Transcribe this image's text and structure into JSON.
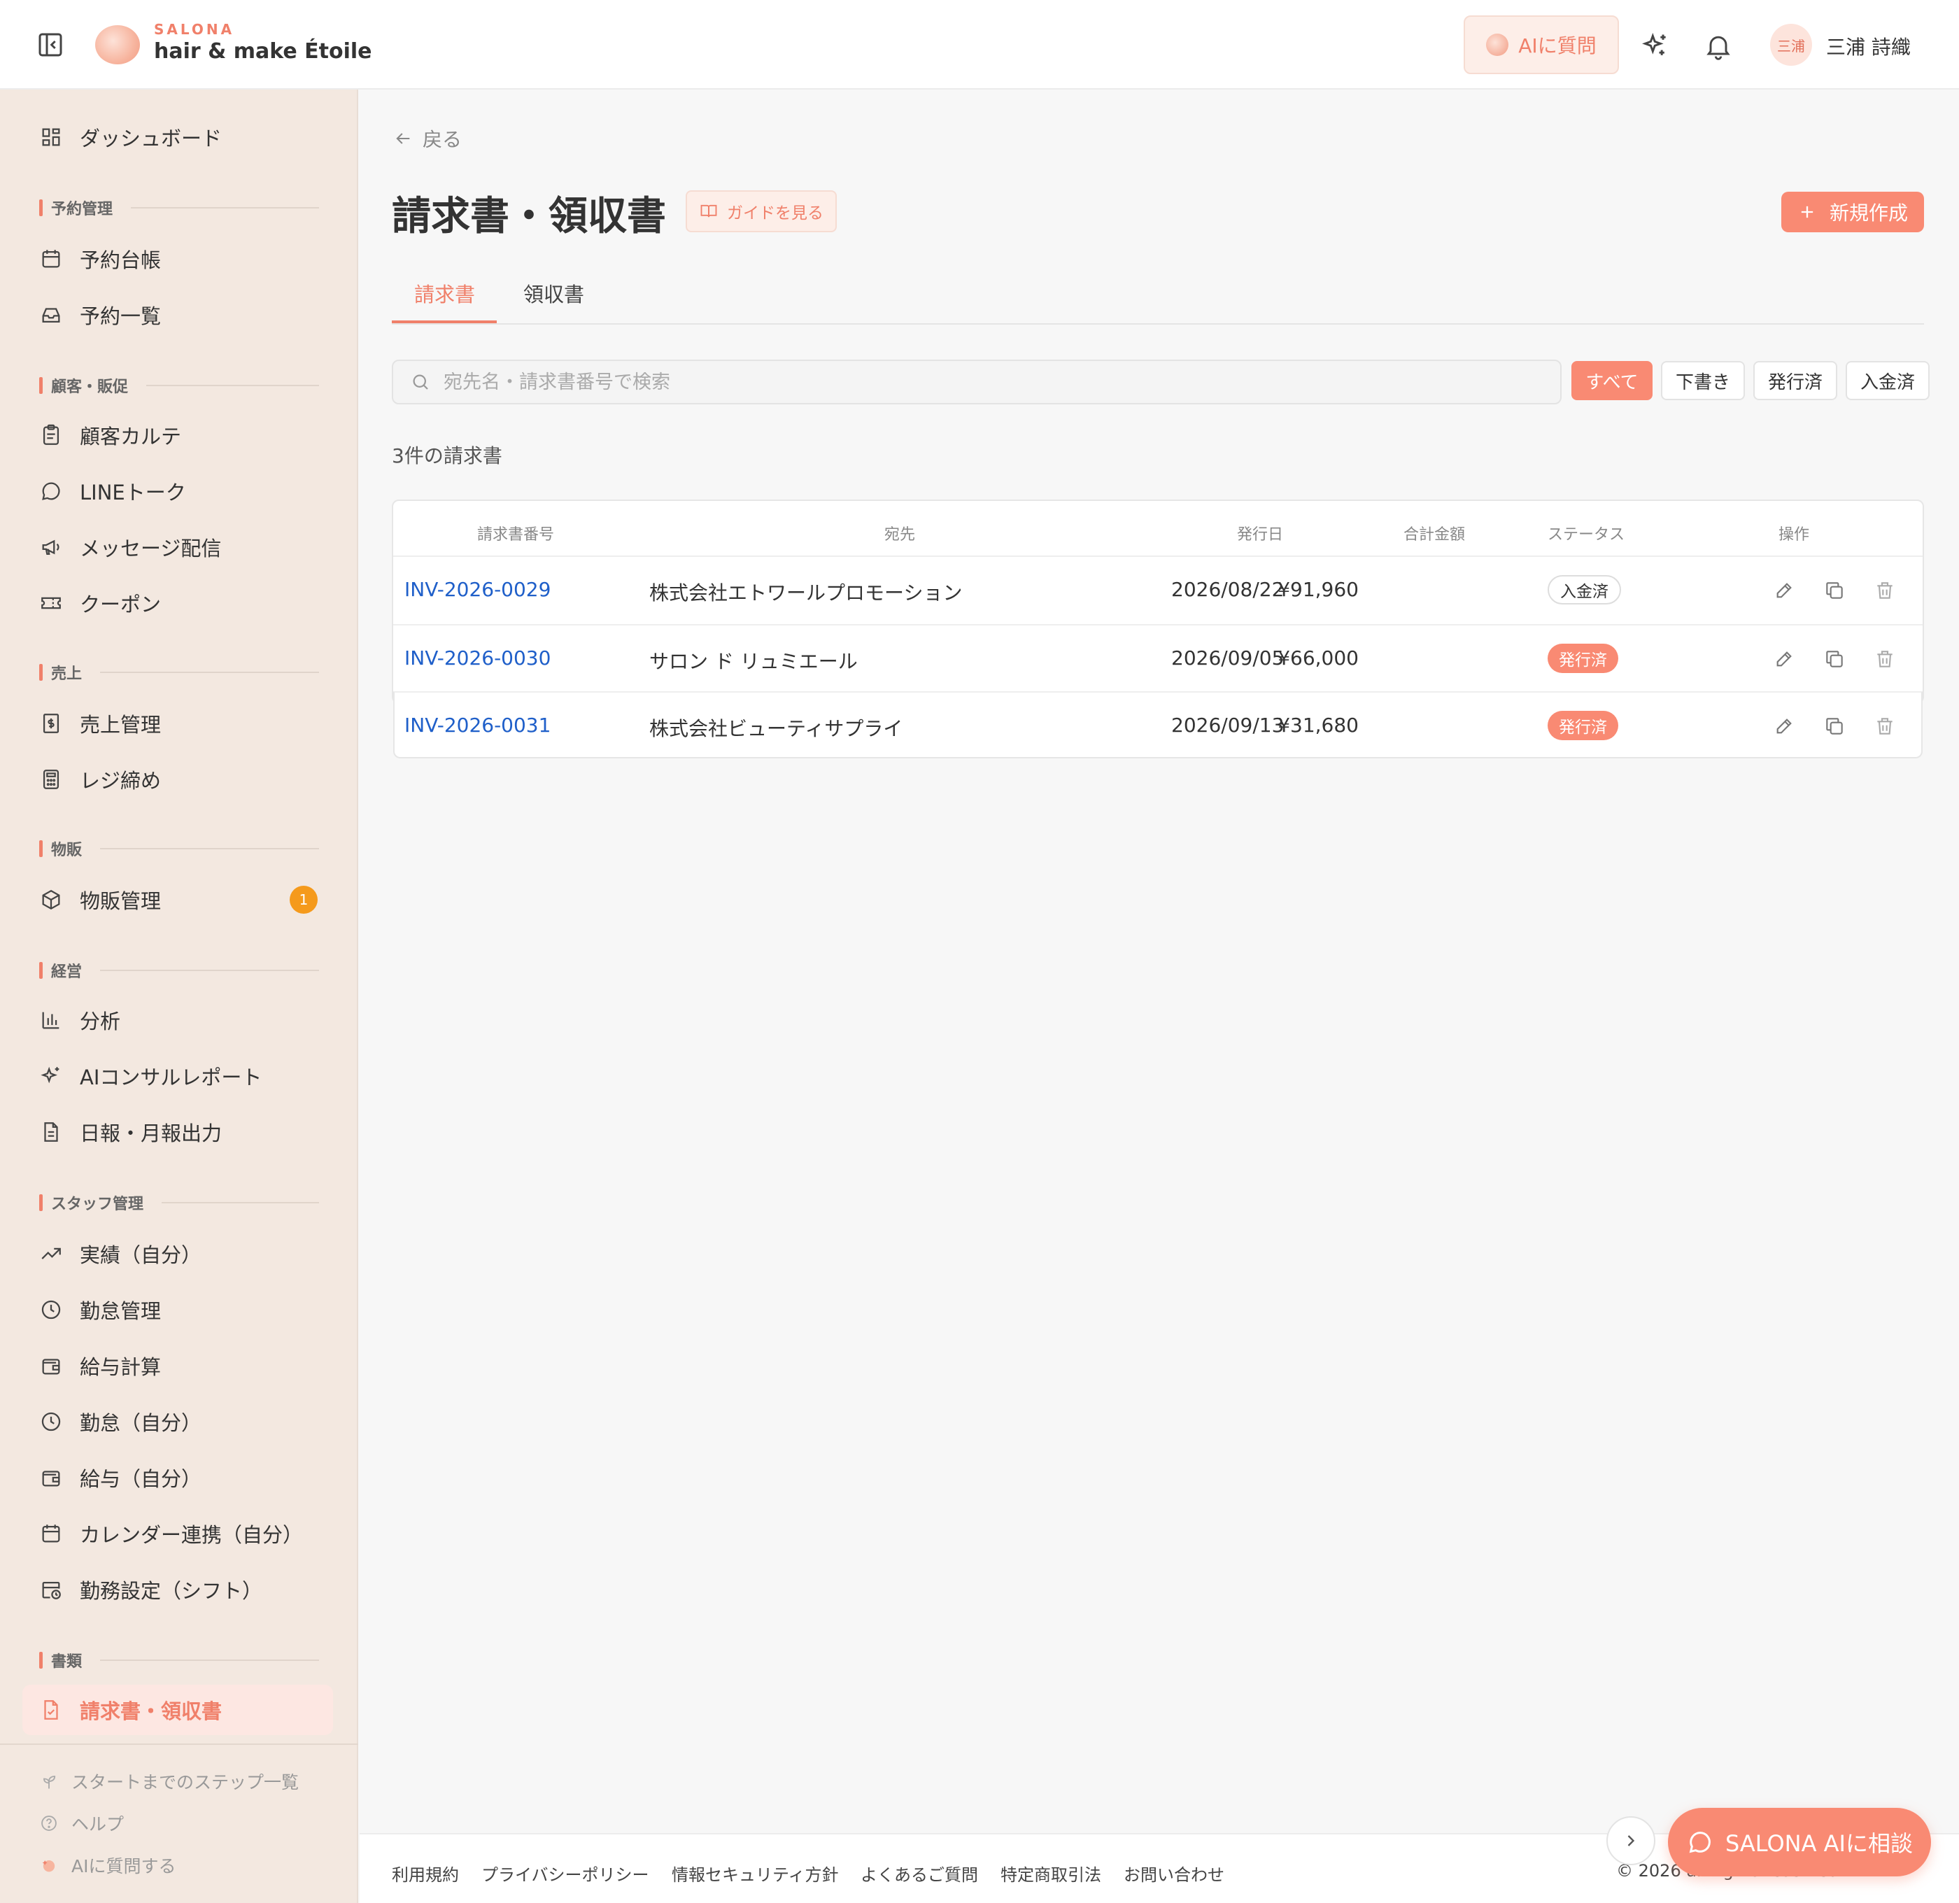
{
  "header": {
    "brand_small": "SALONA",
    "brand_name": "hair & make Étoile",
    "ai_ask": "AIに質問",
    "user_avatar_text": "三浦",
    "user_name": "三浦 詩織"
  },
  "sidebar": {
    "dashboard": "ダッシュボード",
    "sections": {
      "reservations": "予約管理",
      "customers": "顧客・販促",
      "sales": "売上",
      "retail": "物販",
      "management": "経営",
      "staff": "スタッフ管理",
      "documents": "書類"
    },
    "items": {
      "reservation_book": "予約台帳",
      "reservation_list": "予約一覧",
      "customer_chart": "顧客カルテ",
      "line_talk": "LINEトーク",
      "message_delivery": "メッセージ配信",
      "coupon": "クーポン",
      "sales_management": "売上管理",
      "register_close": "レジ締め",
      "retail_management": "物販管理",
      "analysis": "分析",
      "ai_consult_report": "AIコンサルレポート",
      "daily_monthly_report": "日報・月報出力",
      "performance_self": "実績（自分）",
      "attendance_management": "勤怠管理",
      "payroll": "給与計算",
      "attendance_self": "勤怠（自分）",
      "salary_self": "給与（自分）",
      "calendar_sync_self": "カレンダー連携（自分）",
      "work_settings_shift": "勤務設定（シフト）",
      "invoice_receipt": "請求書・領収書"
    },
    "retail_badge": "1",
    "footer": {
      "steps": "スタートまでのステップ一覧",
      "help": "ヘルプ",
      "ai_ask": "AIに質問する"
    }
  },
  "main": {
    "back": "戻る",
    "title": "請求書・領収書",
    "guide": "ガイドを見る",
    "new_button": "新規作成",
    "tabs": {
      "invoice": "請求書",
      "receipt": "領収書"
    },
    "search_placeholder": "宛先名・請求書番号で検索",
    "filters": {
      "all": "すべて",
      "draft": "下書き",
      "issued": "発行済",
      "paid": "入金済"
    },
    "count_text": "3件の請求書",
    "table": {
      "headers": {
        "number": "請求書番号",
        "recipient": "宛先",
        "issue_date": "発行日",
        "total": "合計金額",
        "status": "ステータス",
        "actions": "操作"
      },
      "rows": [
        {
          "number": "INV-2026-0029",
          "recipient": "株式会社エトワールプロモーション",
          "date": "2026/08/22",
          "amount": "¥91,960",
          "status": "入金済"
        },
        {
          "number": "INV-2026-0030",
          "recipient": "サロン ド リュミエール",
          "date": "2026/09/05",
          "amount": "¥66,000",
          "status": "発行済"
        },
        {
          "number": "INV-2026-0031",
          "recipient": "株式会社ビューティサプライ",
          "date": "2026/09/13",
          "amount": "¥31,680",
          "status": "発行済"
        }
      ]
    }
  },
  "footer": {
    "links": [
      "利用規約",
      "プライバシーポリシー",
      "情報セキュリティ方針",
      "よくあるご質問",
      "特定商取引法",
      "お問い合わせ"
    ],
    "copyright": "© 2026 all rights reserved."
  },
  "chat_button": "SALONA AIに相談",
  "colors": {
    "accent": "#f98a73",
    "sidebar_bg": "#f3e8e0",
    "link": "#1f5fc9",
    "badge": "#f59a1c"
  }
}
